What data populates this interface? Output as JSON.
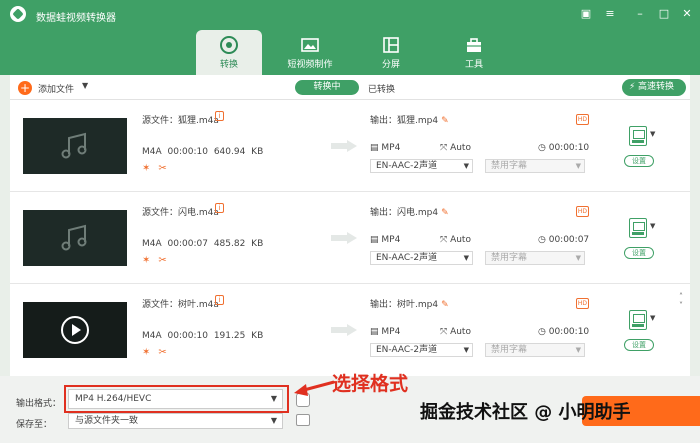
{
  "app": {
    "title": "数据蛙视频转换器"
  },
  "nav": {
    "tabs": [
      {
        "label": "转换",
        "active": true
      },
      {
        "label": "短视频制作",
        "active": false
      },
      {
        "label": "分屏",
        "active": false
      },
      {
        "label": "工具",
        "active": false
      }
    ]
  },
  "toolbar": {
    "add_file": "添加文件",
    "converting": "转换中",
    "converted": "已转换",
    "fast_convert": "高速转换"
  },
  "files": [
    {
      "source": "源文件：狐狸.m4a",
      "format": "M4A",
      "duration": "00:00:10",
      "size": "640.94 KB",
      "output": "输出：狐狸.mp4",
      "out_format": "MP4",
      "resolution": "Auto",
      "out_duration": "00:00:10",
      "audio": "EN-AAC-2声道",
      "subtitle": "禁用字幕",
      "settings": "设置"
    },
    {
      "source": "源文件：闪电.m4a",
      "format": "M4A",
      "duration": "00:00:07",
      "size": "485.82 KB",
      "output": "输出：闪电.mp4",
      "out_format": "MP4",
      "resolution": "Auto",
      "out_duration": "00:00:07",
      "audio": "EN-AAC-2声道",
      "subtitle": "禁用字幕",
      "settings": "设置"
    },
    {
      "source": "源文件：树叶.m4a",
      "format": "M4A",
      "duration": "00:00:10",
      "size": "191.25 KB",
      "output": "输出：树叶.mp4",
      "out_format": "MP4",
      "resolution": "Auto",
      "out_duration": "00:00:10",
      "audio": "EN-AAC-2声道",
      "subtitle": "禁用字幕",
      "settings": "设置"
    }
  ],
  "bottom": {
    "output_format_label": "输出格式：",
    "output_format_value": "MP4 H.264/HEVC",
    "save_to_label": "保存至：",
    "save_to_value": "与源文件夹一致",
    "annotation": "选择格式",
    "watermark": "掘金技术社区 @ 小明助手"
  },
  "colors": {
    "brand": "#3fa066",
    "accent": "#ff6a1a",
    "highlight": "#e03020"
  }
}
